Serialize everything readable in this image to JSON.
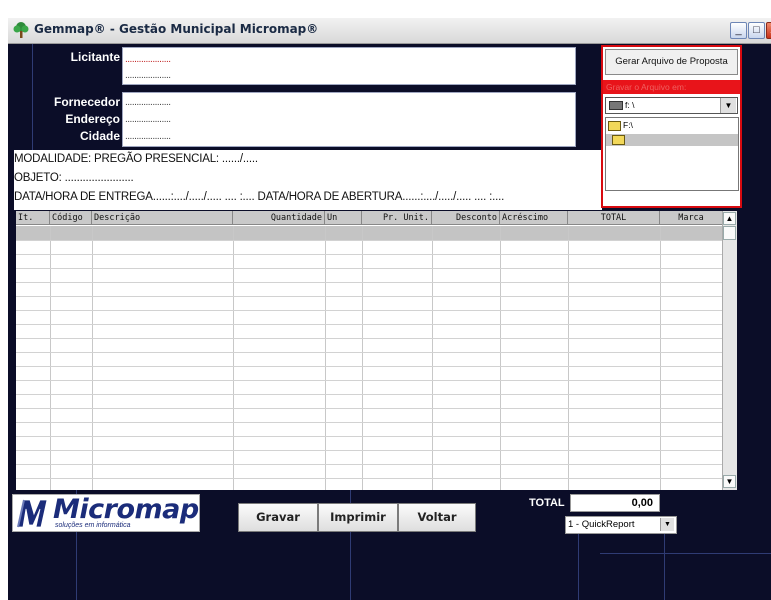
{
  "window": {
    "title": "Gemmap® - Gestão Municipal Micromap®",
    "buttons": {
      "minimize": "_",
      "maximize": "□",
      "close": "X"
    }
  },
  "header": {
    "licitante_label": "Licitante",
    "fornecedor_label": "Fornecedor",
    "endereco_label": "Endereço",
    "cidade_label": "Cidade",
    "dots": "...................."
  },
  "export": {
    "generate_button": "Gerar Arquivo de Proposta",
    "save_in_label": "Gravar o Arquivo em:",
    "drive_value": "f: \\",
    "directory": "F:\\"
  },
  "info": {
    "modalidade": "MODALIDADE: PREGÃO PRESENCIAL:     ....../.....",
    "objeto": "OBJETO: .......................",
    "datas": "DATA/HORA DE ENTREGA......:..../...../..... .... :....  DATA/HORA DE ABERTURA......:..../...../..... .... :...."
  },
  "grid": {
    "columns": [
      "It.",
      "Código",
      "Descrição",
      "Quantidade",
      "Un",
      "Pr. Unit.",
      "Desconto",
      "Acréscimo",
      "TOTAL",
      "Marca"
    ]
  },
  "logo": {
    "name": "Micromap",
    "tagline": "soluções em informática"
  },
  "footer": {
    "gravar": "Gravar",
    "imprimir": "Imprimir",
    "voltar": "Voltar",
    "total_label": "TOTAL",
    "total_value": "0,00",
    "report_option": "1 - QuickReport"
  },
  "colors": {
    "background": "#0b0d28",
    "highlight_red": "#d80a10",
    "brand_blue": "#1b2c7a"
  },
  "icons": [
    "app-tree-icon",
    "drive-icon",
    "folder-open-icon",
    "dropdown-arrow-icon",
    "scroll-up-icon",
    "scroll-down-icon"
  ]
}
